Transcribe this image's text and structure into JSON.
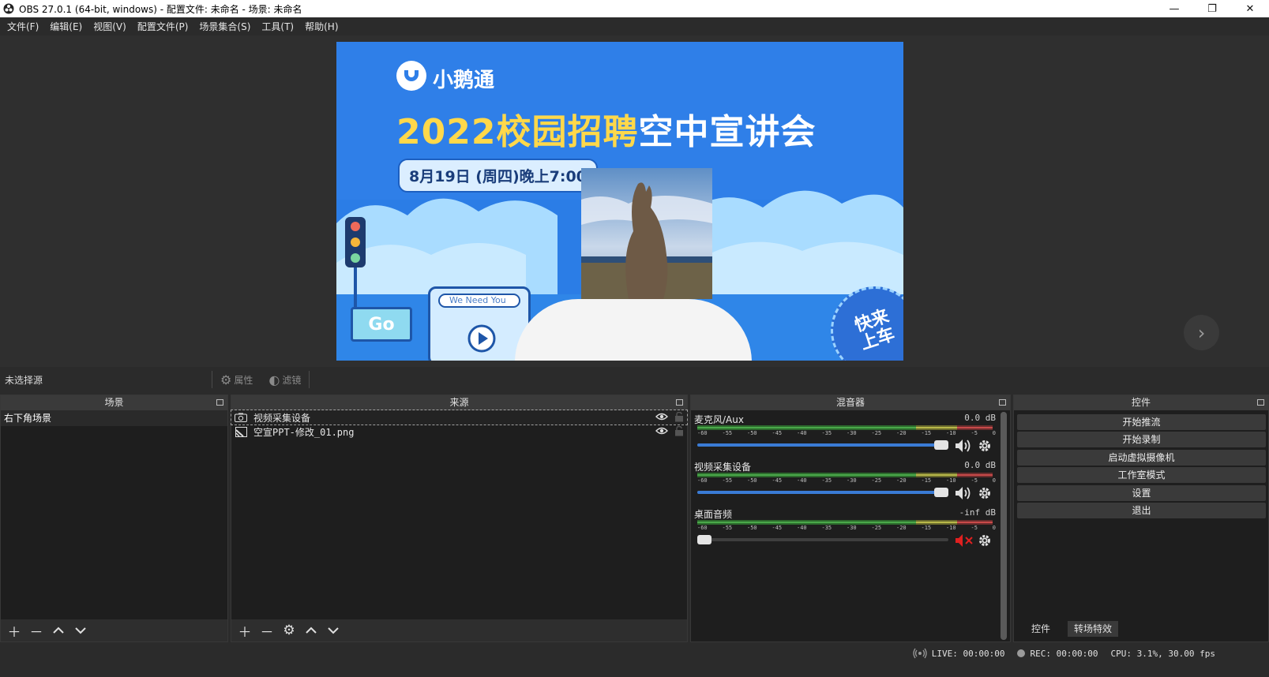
{
  "window": {
    "title": "OBS 27.0.1 (64-bit, windows) - 配置文件: 未命名 - 场景: 未命名",
    "minimize": "—",
    "restore": "❐",
    "close": "✕"
  },
  "menu": [
    "文件(F)",
    "编辑(E)",
    "视图(V)",
    "配置文件(P)",
    "场景集合(S)",
    "工具(T)",
    "帮助(H)"
  ],
  "preview": {
    "brand": "小鹅通",
    "headline_yellow": "2022校园招聘",
    "headline_white": "空中宣讲会",
    "date": "8月19日 (周四)晚上7:00",
    "search_text": "We Need You",
    "go_text": "Go",
    "badge_text_1": "快来",
    "badge_text_2": "上车",
    "next_arrow": "›"
  },
  "source_toolbar": {
    "no_source": "未选择源",
    "properties": "属性",
    "filters": "滤镜"
  },
  "scenes": {
    "header": "场景",
    "items": [
      "右下角场景"
    ]
  },
  "sources": {
    "header": "来源",
    "items": [
      {
        "name": "视频采集设备",
        "icon": "camera-icon"
      },
      {
        "name": "空宣PPT-修改_01.png",
        "icon": "image-icon"
      }
    ]
  },
  "mixer": {
    "header": "混音器",
    "ticks": [
      "-60",
      "-55",
      "-50",
      "-45",
      "-40",
      "-35",
      "-30",
      "-25",
      "-20",
      "-15",
      "-10",
      "-5",
      "0"
    ],
    "channels": [
      {
        "name": "麦克风/Aux",
        "db": "0.0 dB",
        "level": 1.0,
        "muted": false
      },
      {
        "name": "视频采集设备",
        "db": "0.0 dB",
        "level": 1.0,
        "muted": false
      },
      {
        "name": "桌面音频",
        "db": "-inf dB",
        "level": 0.0,
        "muted": true
      }
    ]
  },
  "controls": {
    "header": "控件",
    "buttons": [
      "开始推流",
      "开始录制",
      "启动虚拟摄像机",
      "工作室模式",
      "设置",
      "退出"
    ],
    "tabs": [
      "控件",
      "转场特效"
    ]
  },
  "status": {
    "live": "LIVE: 00:00:00",
    "rec": "REC: 00:00:00",
    "cpu": "CPU: 3.1%, 30.00 fps"
  },
  "colors": {
    "accent": "#3a7bd5",
    "muted_icon": "#e02020",
    "panel_bg": "#1e1e1e",
    "window_bg": "#2b2b2b"
  }
}
